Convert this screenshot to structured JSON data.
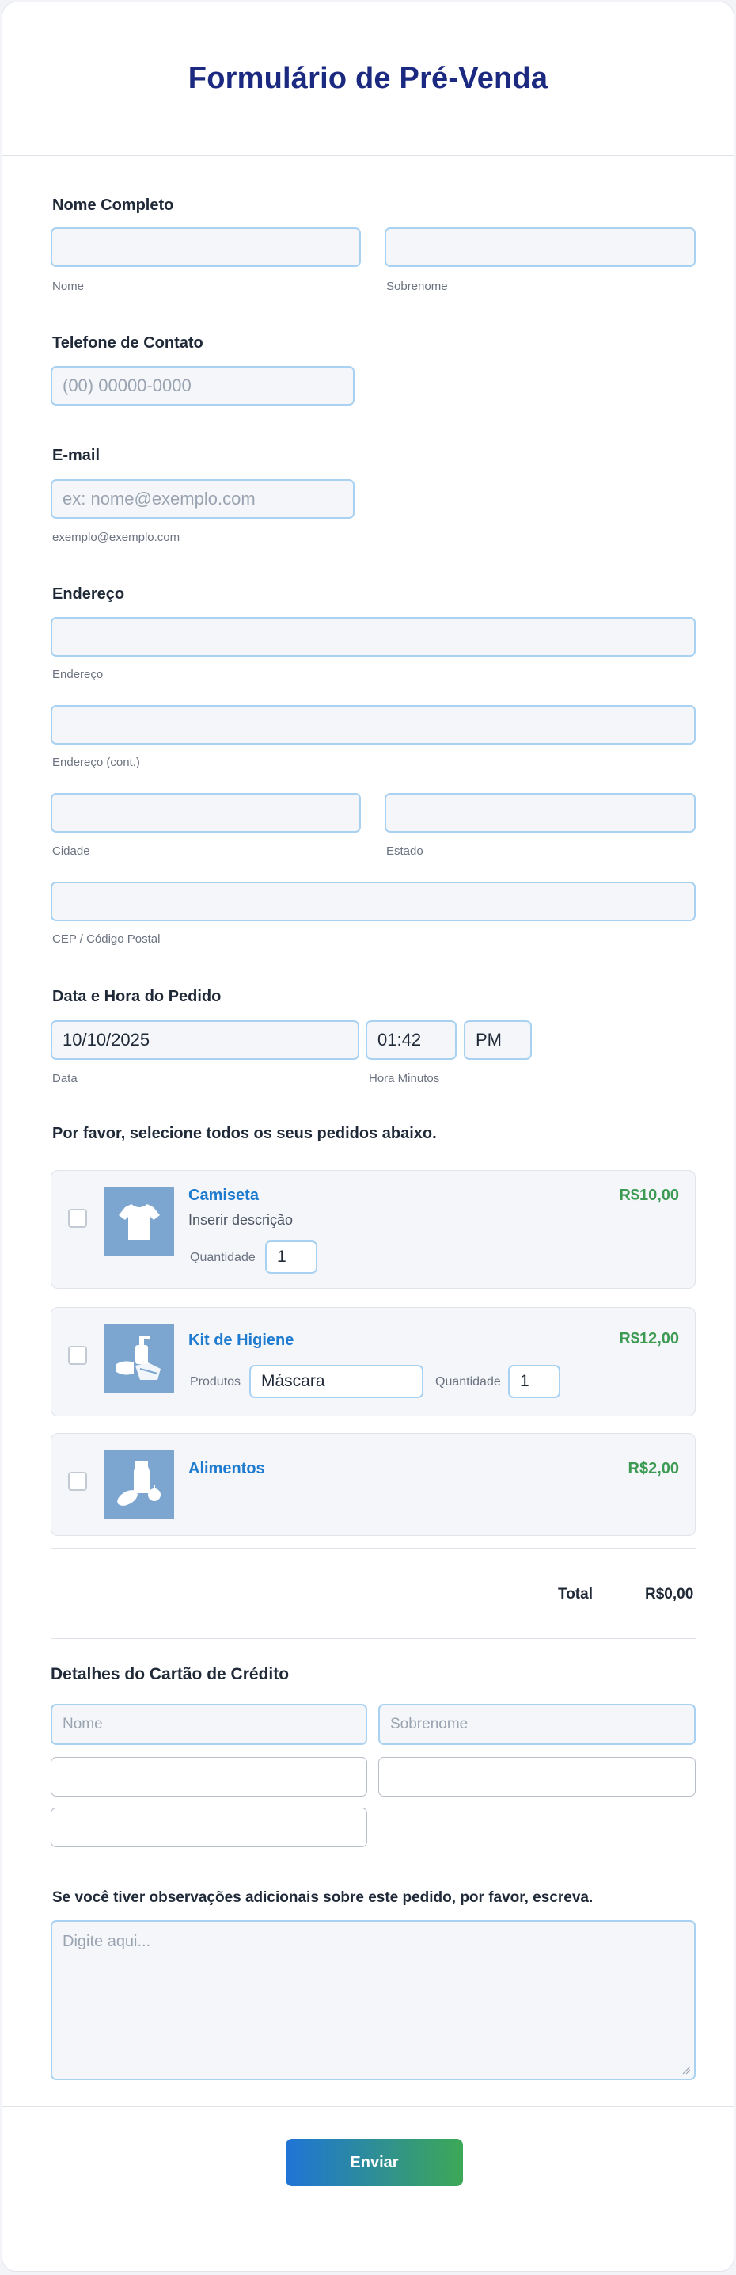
{
  "form": {
    "title": "Formulário de Pré-Venda",
    "full_name": {
      "label": "Nome Completo",
      "first_sublabel": "Nome",
      "last_sublabel": "Sobrenome"
    },
    "phone": {
      "label": "Telefone de Contato",
      "placeholder": "(00) 00000-0000"
    },
    "email": {
      "label": "E-mail",
      "placeholder": "ex: nome@exemplo.com",
      "sublabel": "exemplo@exemplo.com"
    },
    "address": {
      "label": "Endereço",
      "line1_sublabel": "Endereço",
      "line2_sublabel": "Endereço (cont.)",
      "city_sublabel": "Cidade",
      "state_sublabel": "Estado",
      "zip_sublabel": "CEP / Código Postal"
    },
    "order_datetime": {
      "label": "Data e Hora do Pedido",
      "date_value": "10/10/2025",
      "time_value": "01:42",
      "ampm_value": "PM",
      "date_sublabel": "Data",
      "time_sublabel": "Hora Minutos"
    },
    "products": {
      "label": "Por favor, selecione todos os seus pedidos abaixo.",
      "items": [
        {
          "name": "Camiseta",
          "price": "R$10,00",
          "description": "Inserir descrição",
          "qty_label": "Quantidade",
          "qty_value": "1",
          "icon": "tshirt-icon",
          "checked": false
        },
        {
          "name": "Kit de Higiene",
          "price": "R$12,00",
          "options_label": "Produtos",
          "option_value": "Máscara",
          "qty_label": "Quantidade",
          "qty_value": "1",
          "icon": "hygiene-kit-icon",
          "checked": false
        },
        {
          "name": "Alimentos",
          "price": "R$2,00",
          "icon": "groceries-icon",
          "checked": false
        }
      ],
      "total_label": "Total",
      "total_value": "R$0,00"
    },
    "credit_card": {
      "label": "Detalhes do Cartão de Crédito",
      "first_placeholder": "Nome",
      "last_placeholder": "Sobrenome"
    },
    "notes": {
      "label": "Se você tiver observações adicionais sobre este pedido, por favor, escreva.",
      "placeholder": "Digite aqui..."
    },
    "submit_label": "Enviar"
  },
  "colors": {
    "title": "#1b2a80",
    "product_name": "#1f7bcf",
    "price": "#3c9a52",
    "input_border": "#a9d2f2",
    "input_bg": "#f4f6fa",
    "thumb_bg": "#7ca5cf",
    "button_gradient_start": "#1f74d6",
    "button_gradient_end": "#3da856"
  }
}
